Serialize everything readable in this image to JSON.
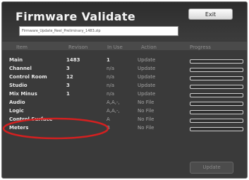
{
  "window": {
    "title": "Firmware Validate",
    "exit_label": "Exit",
    "file_name": "Firmware_Update_Reel_Preliminary_1483.zip"
  },
  "table": {
    "headers": [
      "Item",
      "Revison",
      "In Use",
      "Action",
      "Progress"
    ],
    "rows": [
      {
        "item": "Main",
        "revision": "1483",
        "in_use": "1",
        "action": "Update",
        "progress": 0
      },
      {
        "item": "Channel",
        "revision": "3",
        "in_use": "n/a",
        "action": "Update",
        "progress": 0
      },
      {
        "item": "Control Room",
        "revision": "12",
        "in_use": "n/a",
        "action": "Update",
        "progress": 0
      },
      {
        "item": "Studio",
        "revision": "3",
        "in_use": "n/a",
        "action": "Update",
        "progress": 0
      },
      {
        "item": "Mix Minus",
        "revision": "1",
        "in_use": "n/a",
        "action": "Update",
        "progress": 0
      },
      {
        "item": "Audio",
        "revision": "",
        "in_use": "A,A,-,",
        "action": "No File",
        "progress": 0
      },
      {
        "item": "Logic",
        "revision": "",
        "in_use": "A,A,-,",
        "action": "No File",
        "progress": 0
      },
      {
        "item": "Control Surface",
        "revision": "",
        "in_use": "A",
        "action": "No File",
        "progress": 0
      },
      {
        "item": "Meters",
        "revision": "",
        "in_use": "B",
        "action": "No File",
        "progress": 0
      }
    ]
  },
  "update_label": "Update",
  "colors": {
    "annotation": "#d42020",
    "panel": "#3a3a3a"
  }
}
